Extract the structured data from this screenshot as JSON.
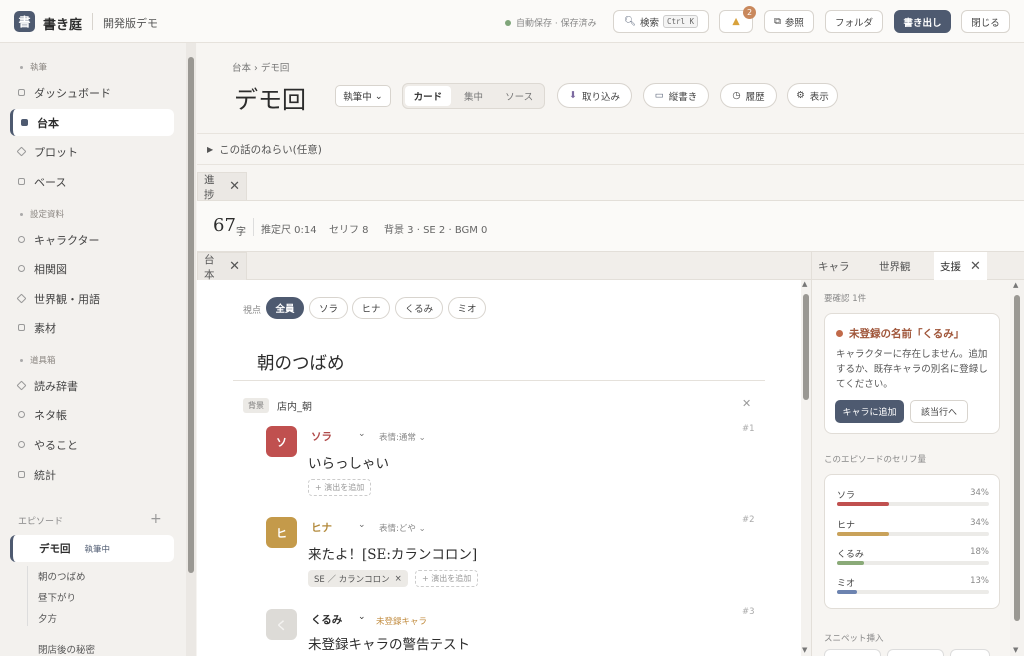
{
  "app": {
    "logo": "書",
    "name": "書き庭",
    "subtitle": "開発版デモ"
  },
  "topbar": {
    "autosave": "自動保存 · 保存済み",
    "search_label": "検索",
    "search_kbd": "Ctrl K",
    "bell_count": "2",
    "ref_label": "参照",
    "folder_label": "フォルダ",
    "export_label": "書き出し",
    "close_label": "閉じる"
  },
  "sidebar": {
    "sections": [
      "執筆",
      "設定資料",
      "道具箱"
    ],
    "items": [
      {
        "label": "ダッシュボード"
      },
      {
        "label": "台本"
      },
      {
        "label": "プロット"
      },
      {
        "label": "ベース"
      },
      {
        "label": "キャラクター"
      },
      {
        "label": "相関図"
      },
      {
        "label": "世界観・用語"
      },
      {
        "label": "素材"
      },
      {
        "label": "読み辞書"
      },
      {
        "label": "ネタ帳"
      },
      {
        "label": "やること"
      },
      {
        "label": "統計"
      }
    ],
    "episodes_label": "エピソード",
    "episode_add": "+",
    "active_episode": {
      "title": "デモ回",
      "status": "執筆中"
    },
    "scenes": [
      "朝のつばめ",
      "昼下がり",
      "夕方"
    ],
    "other_episode": "閉店後の秘密"
  },
  "main": {
    "breadcrumb": "台本  ›  デモ回",
    "title": "デモ回",
    "status": "執筆中",
    "view_modes": [
      "カード",
      "集中",
      "ソース"
    ],
    "import_label": "取り込み",
    "vertical_label": "縦書き",
    "history_label": "履歴",
    "display_label": "表示",
    "aim": "この話のねらい(任意)"
  },
  "progress": {
    "tab_label": "進捗",
    "chars": "67",
    "chars_unit": "字",
    "estimate": "推定尺 0:14",
    "lines": "セリフ 8",
    "background": "背景 3 · SE 2 · BGM 0"
  },
  "script": {
    "tab_label": "台本",
    "pov_label": "視点",
    "pov_options": [
      "全員",
      "ソラ",
      "ヒナ",
      "くるみ",
      "ミオ"
    ],
    "scene_title": "朝のつばめ",
    "bg_tag": "背景",
    "bg_name": "店内_朝",
    "lines": [
      {
        "initial": "ソ",
        "name": "ソラ",
        "expression": "表情:通常",
        "num": "#1",
        "text": "いらっしゃい",
        "add": "+ 演出を追加",
        "color": "#c0504f"
      },
      {
        "initial": "ヒ",
        "name": "ヒナ",
        "expression": "表情:どや",
        "num": "#2",
        "text": "来たよ！[SE:カランコロン]",
        "se_chip": "SE ／ カランコロン",
        "add": "+ 演出を追加",
        "color": "#c49a4a"
      },
      {
        "initial": "く",
        "name": "くるみ",
        "warning": "未登録キャラ",
        "num": "#3",
        "text": "未登録キャラの警告テスト",
        "color": "#d8d6d2"
      }
    ]
  },
  "right_panel": {
    "tabs": [
      "キャラ",
      "世界観",
      "支援"
    ],
    "check_label": "要確認  1件",
    "alert_title": "未登録の名前「くるみ」",
    "alert_body": "キャラクターに存在しません。追加するか、既存キャラの別名に登録してください。",
    "add_char_btn": "キャラに追加",
    "goto_line_btn": "該当行へ",
    "dialogue_share_label": "このエピソードのセリフ量",
    "dialogue_share": [
      {
        "name": "ソラ",
        "pct": "34%",
        "value": 34,
        "color": "#c0504f"
      },
      {
        "name": "ヒナ",
        "pct": "34%",
        "value": 34,
        "color": "#c9a25a"
      },
      {
        "name": "くるみ",
        "pct": "18%",
        "value": 18,
        "color": "#8aaa78"
      },
      {
        "name": "ミオ",
        "pct": "13%",
        "value": 13,
        "color": "#6c83b0"
      }
    ],
    "snippet_label": "スニペット挿入"
  }
}
